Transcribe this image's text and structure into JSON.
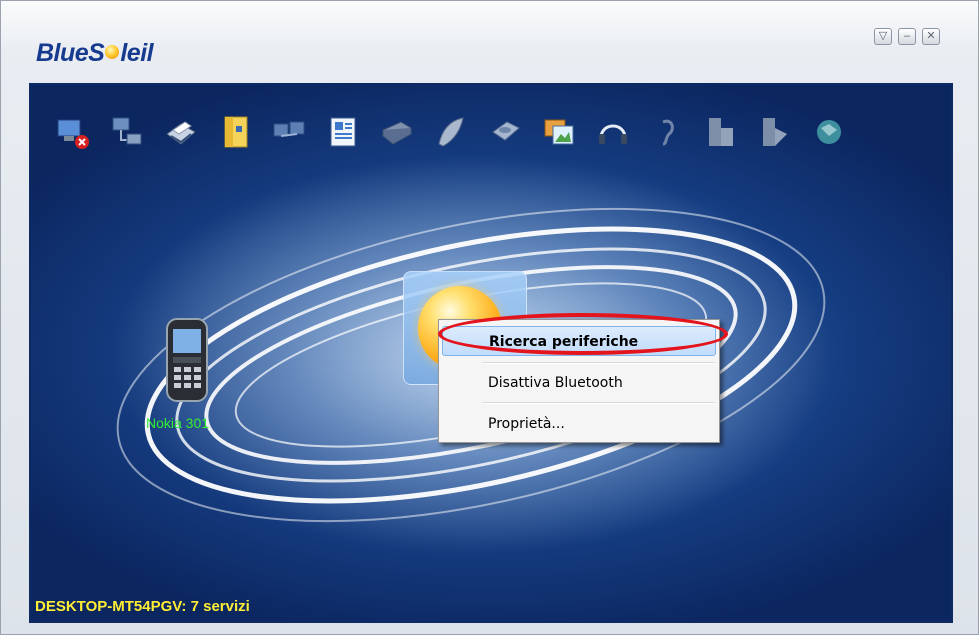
{
  "app": {
    "logo_text_pre": "BlueS",
    "logo_text_post": "leil"
  },
  "window_controls": {
    "minimize_to_tray_icon": "arrow-down-box-icon",
    "minimize_icon": "minimize-icon",
    "close_icon": "close-icon"
  },
  "toolbar": {
    "services": [
      "network-access-icon",
      "dial-up-networking-icon",
      "printer-icon",
      "file-transfer-icon",
      "personal-area-network-icon",
      "contacts-sync-icon",
      "fax-icon",
      "hid-mouse-icon",
      "serial-port-icon",
      "image-transfer-icon",
      "headset-icon",
      "hearing-aid-icon",
      "object-push-icon",
      "file-sync-icon",
      "av-remote-icon"
    ]
  },
  "devices": {
    "phone_label": "Nokia 301"
  },
  "context_menu": {
    "items": [
      {
        "label": "Ricerca periferiche",
        "selected": true
      },
      {
        "label": "Disattiva Bluetooth",
        "selected": false
      },
      {
        "label": "Proprietà...",
        "selected": false
      }
    ]
  },
  "status": {
    "text": "DESKTOP-MT54PGV: 7 servizi"
  },
  "colors": {
    "stage_blue": "#153c80",
    "status_yellow": "#ffee33",
    "phone_label_green": "#33ee33",
    "highlight_red": "#e3141b"
  }
}
